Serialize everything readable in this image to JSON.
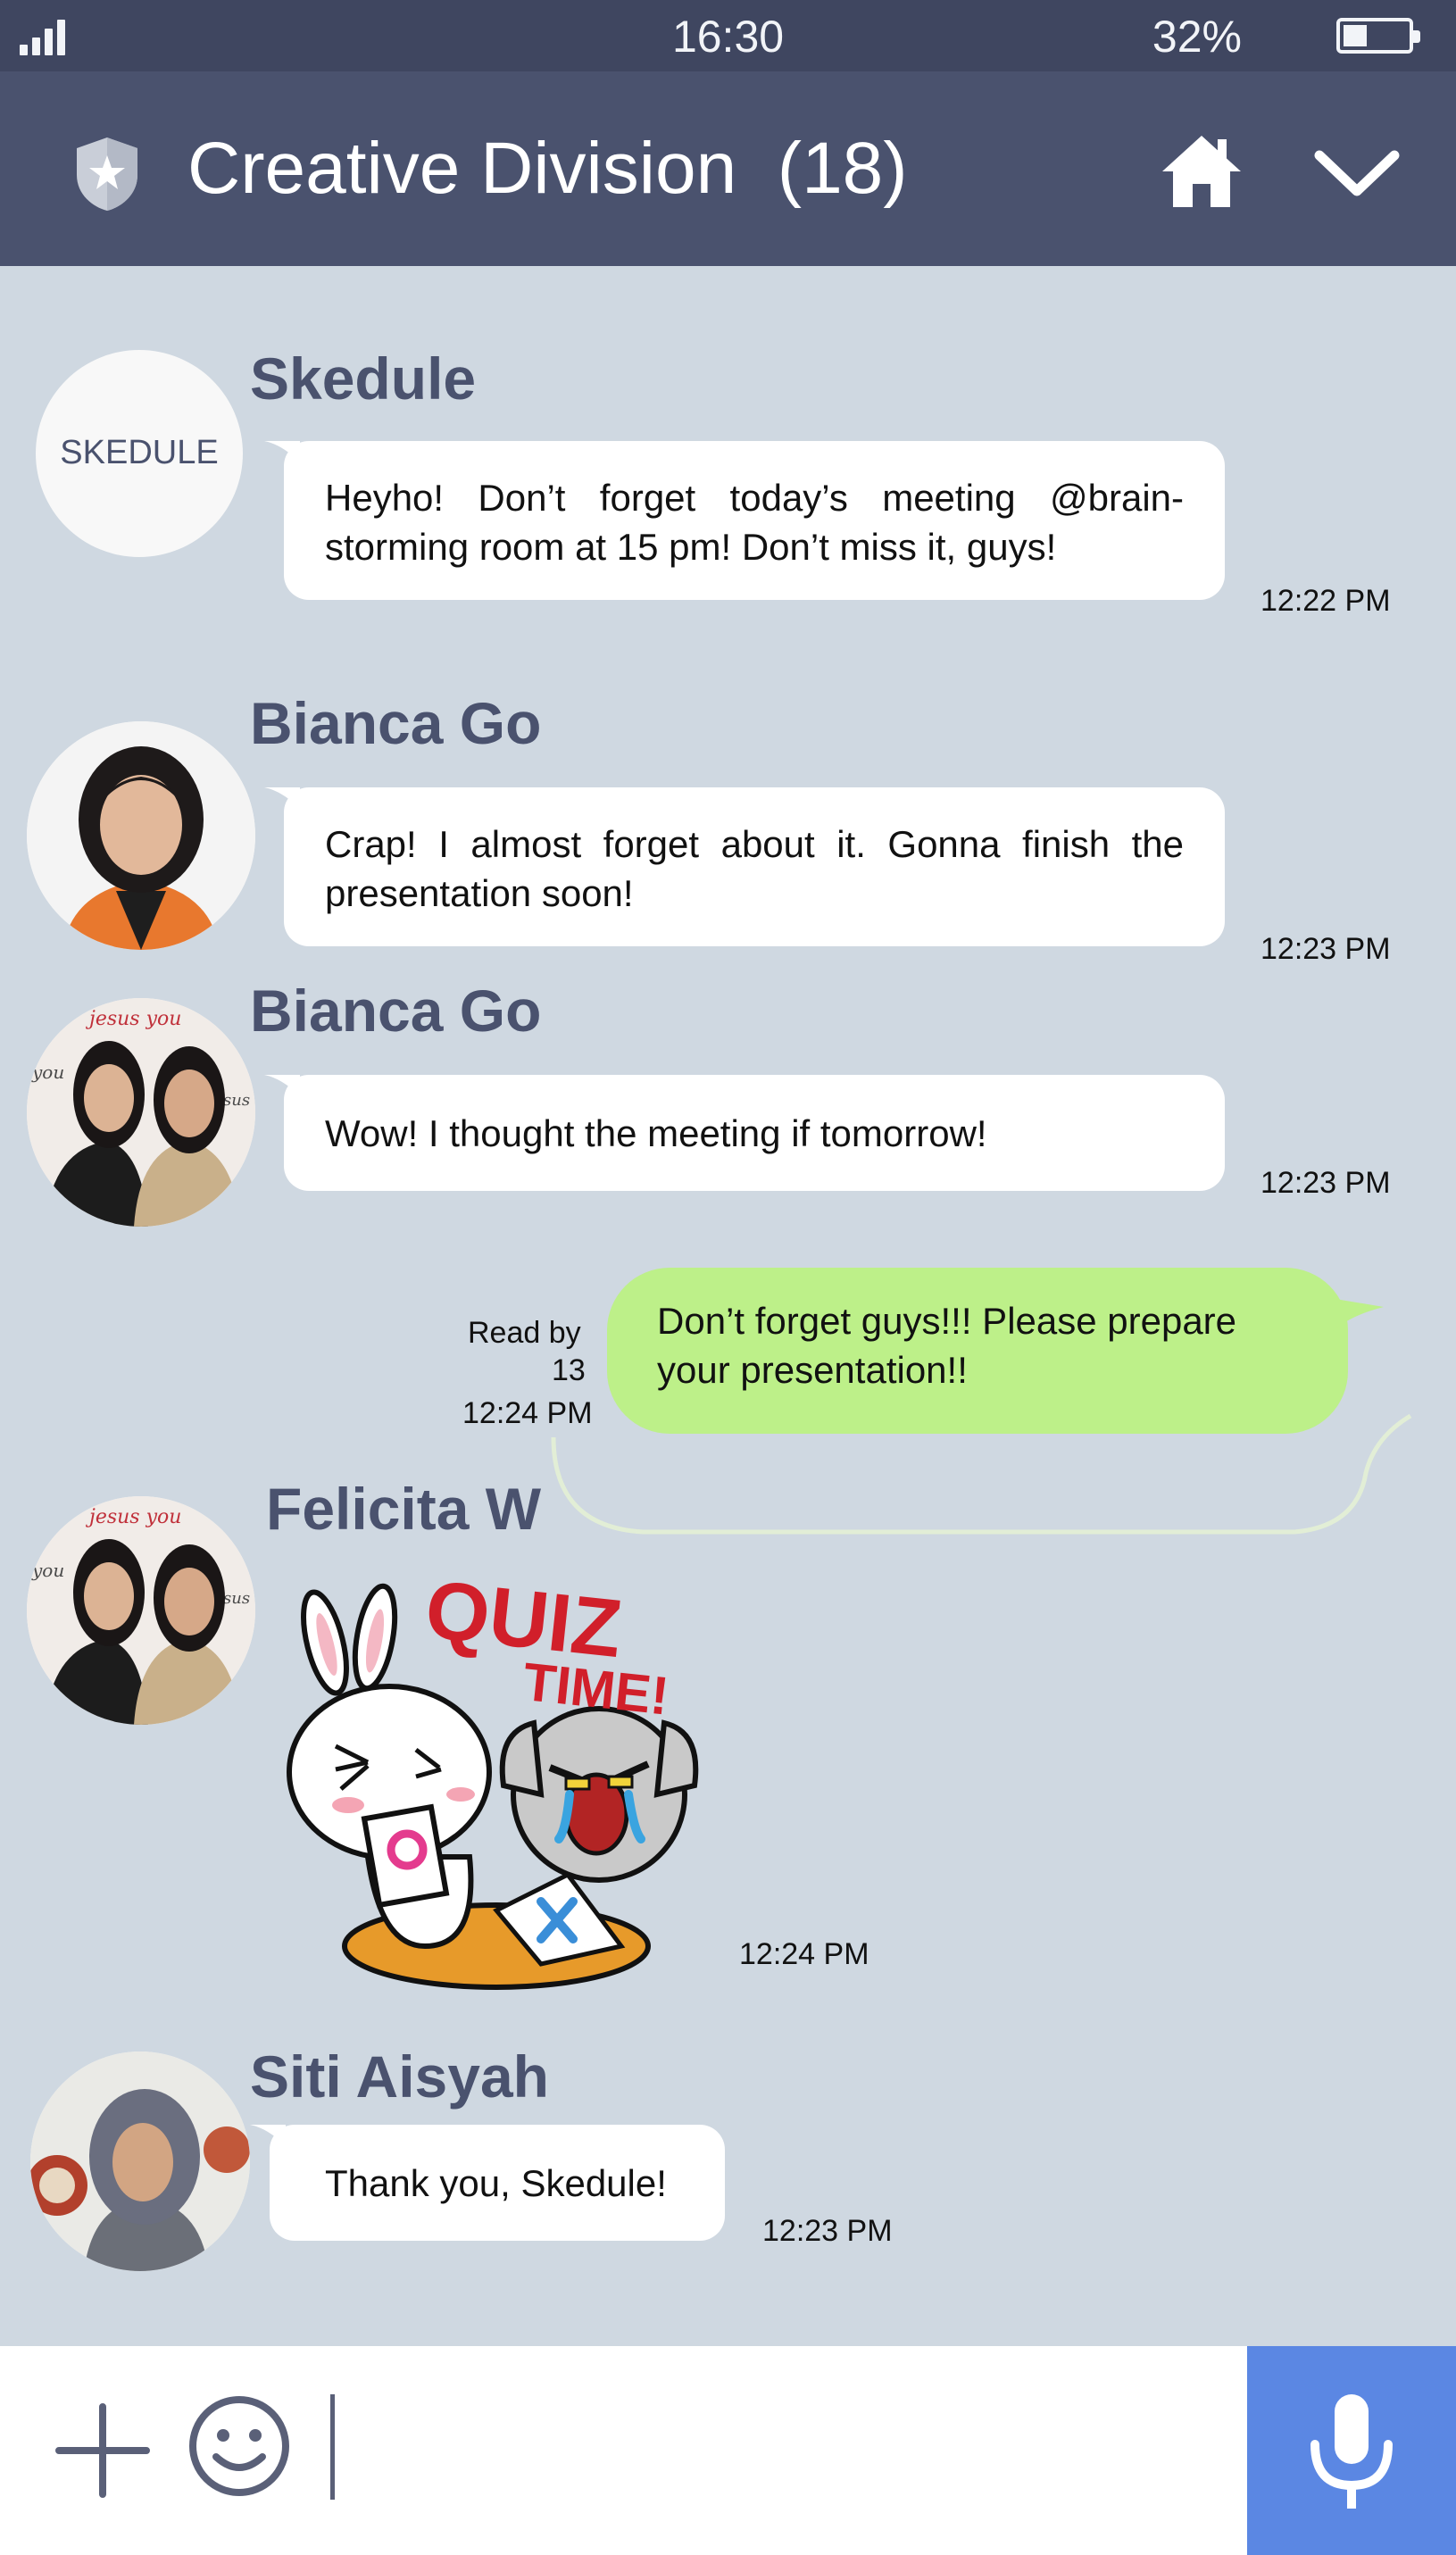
{
  "status_bar": {
    "time": "16:30",
    "battery": "32%"
  },
  "header": {
    "title": "Creative Division  (18)"
  },
  "messages": [
    {
      "sender": "Skedule",
      "avatar_text": "SKEDULE",
      "text": "Heyho! Don’t forget today’s meeting @brain-storming room at 15 pm! Don’t miss it, guys!",
      "time": "12:22 PM"
    },
    {
      "sender": "Bianca Go",
      "text": "Crap! I almost forget about it. Gonna finish the presentation soon!",
      "time": "12:23 PM"
    },
    {
      "sender": "Bianca Go",
      "text": "Wow! I thought the meeting if tomorrow!",
      "time": "12:23 PM"
    },
    {
      "outgoing": true,
      "read_label": "Read by",
      "read_count": "13",
      "text": "Don’t forget guys!!! Please prepare your presentation!!",
      "time": "12:24 PM"
    },
    {
      "sender": "Felicita W",
      "sticker_text_1": "QUIZ",
      "sticker_text_2": "TIME!",
      "time": "12:24 PM"
    },
    {
      "sender": "Siti Aisyah",
      "text": "Thank you, Skedule!",
      "time": "12:23 PM"
    }
  ],
  "colors": {
    "header_bg": "#4a526e",
    "status_bg": "#3f4660",
    "chat_bg": "#cfd8e1",
    "incoming_bubble": "#ffffff",
    "outgoing_bubble": "#bdf089",
    "sender_name": "#4a526e",
    "mic_button": "#5b87e3"
  },
  "icons": [
    "signal-icon",
    "battery-icon",
    "group-shield-icon",
    "home-icon",
    "chevron-down-icon",
    "plus-icon",
    "emoji-icon",
    "microphone-icon"
  ]
}
